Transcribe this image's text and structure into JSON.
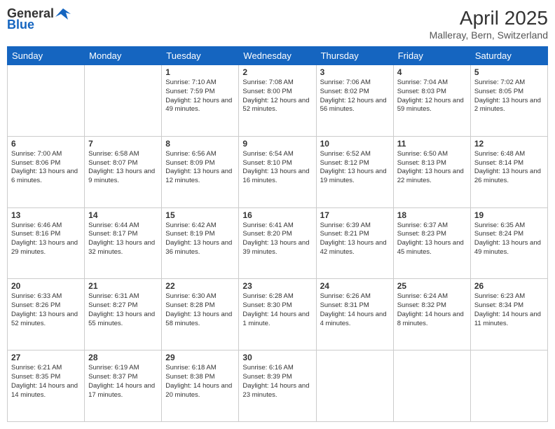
{
  "logo": {
    "general": "General",
    "blue": "Blue"
  },
  "title": "April 2025",
  "location": "Malleray, Bern, Switzerland",
  "days_header": [
    "Sunday",
    "Monday",
    "Tuesday",
    "Wednesday",
    "Thursday",
    "Friday",
    "Saturday"
  ],
  "weeks": [
    [
      {
        "day": "",
        "text": ""
      },
      {
        "day": "",
        "text": ""
      },
      {
        "day": "1",
        "text": "Sunrise: 7:10 AM\nSunset: 7:59 PM\nDaylight: 12 hours and 49 minutes."
      },
      {
        "day": "2",
        "text": "Sunrise: 7:08 AM\nSunset: 8:00 PM\nDaylight: 12 hours and 52 minutes."
      },
      {
        "day": "3",
        "text": "Sunrise: 7:06 AM\nSunset: 8:02 PM\nDaylight: 12 hours and 56 minutes."
      },
      {
        "day": "4",
        "text": "Sunrise: 7:04 AM\nSunset: 8:03 PM\nDaylight: 12 hours and 59 minutes."
      },
      {
        "day": "5",
        "text": "Sunrise: 7:02 AM\nSunset: 8:05 PM\nDaylight: 13 hours and 2 minutes."
      }
    ],
    [
      {
        "day": "6",
        "text": "Sunrise: 7:00 AM\nSunset: 8:06 PM\nDaylight: 13 hours and 6 minutes."
      },
      {
        "day": "7",
        "text": "Sunrise: 6:58 AM\nSunset: 8:07 PM\nDaylight: 13 hours and 9 minutes."
      },
      {
        "day": "8",
        "text": "Sunrise: 6:56 AM\nSunset: 8:09 PM\nDaylight: 13 hours and 12 minutes."
      },
      {
        "day": "9",
        "text": "Sunrise: 6:54 AM\nSunset: 8:10 PM\nDaylight: 13 hours and 16 minutes."
      },
      {
        "day": "10",
        "text": "Sunrise: 6:52 AM\nSunset: 8:12 PM\nDaylight: 13 hours and 19 minutes."
      },
      {
        "day": "11",
        "text": "Sunrise: 6:50 AM\nSunset: 8:13 PM\nDaylight: 13 hours and 22 minutes."
      },
      {
        "day": "12",
        "text": "Sunrise: 6:48 AM\nSunset: 8:14 PM\nDaylight: 13 hours and 26 minutes."
      }
    ],
    [
      {
        "day": "13",
        "text": "Sunrise: 6:46 AM\nSunset: 8:16 PM\nDaylight: 13 hours and 29 minutes."
      },
      {
        "day": "14",
        "text": "Sunrise: 6:44 AM\nSunset: 8:17 PM\nDaylight: 13 hours and 32 minutes."
      },
      {
        "day": "15",
        "text": "Sunrise: 6:42 AM\nSunset: 8:19 PM\nDaylight: 13 hours and 36 minutes."
      },
      {
        "day": "16",
        "text": "Sunrise: 6:41 AM\nSunset: 8:20 PM\nDaylight: 13 hours and 39 minutes."
      },
      {
        "day": "17",
        "text": "Sunrise: 6:39 AM\nSunset: 8:21 PM\nDaylight: 13 hours and 42 minutes."
      },
      {
        "day": "18",
        "text": "Sunrise: 6:37 AM\nSunset: 8:23 PM\nDaylight: 13 hours and 45 minutes."
      },
      {
        "day": "19",
        "text": "Sunrise: 6:35 AM\nSunset: 8:24 PM\nDaylight: 13 hours and 49 minutes."
      }
    ],
    [
      {
        "day": "20",
        "text": "Sunrise: 6:33 AM\nSunset: 8:26 PM\nDaylight: 13 hours and 52 minutes."
      },
      {
        "day": "21",
        "text": "Sunrise: 6:31 AM\nSunset: 8:27 PM\nDaylight: 13 hours and 55 minutes."
      },
      {
        "day": "22",
        "text": "Sunrise: 6:30 AM\nSunset: 8:28 PM\nDaylight: 13 hours and 58 minutes."
      },
      {
        "day": "23",
        "text": "Sunrise: 6:28 AM\nSunset: 8:30 PM\nDaylight: 14 hours and 1 minute."
      },
      {
        "day": "24",
        "text": "Sunrise: 6:26 AM\nSunset: 8:31 PM\nDaylight: 14 hours and 4 minutes."
      },
      {
        "day": "25",
        "text": "Sunrise: 6:24 AM\nSunset: 8:32 PM\nDaylight: 14 hours and 8 minutes."
      },
      {
        "day": "26",
        "text": "Sunrise: 6:23 AM\nSunset: 8:34 PM\nDaylight: 14 hours and 11 minutes."
      }
    ],
    [
      {
        "day": "27",
        "text": "Sunrise: 6:21 AM\nSunset: 8:35 PM\nDaylight: 14 hours and 14 minutes."
      },
      {
        "day": "28",
        "text": "Sunrise: 6:19 AM\nSunset: 8:37 PM\nDaylight: 14 hours and 17 minutes."
      },
      {
        "day": "29",
        "text": "Sunrise: 6:18 AM\nSunset: 8:38 PM\nDaylight: 14 hours and 20 minutes."
      },
      {
        "day": "30",
        "text": "Sunrise: 6:16 AM\nSunset: 8:39 PM\nDaylight: 14 hours and 23 minutes."
      },
      {
        "day": "",
        "text": ""
      },
      {
        "day": "",
        "text": ""
      },
      {
        "day": "",
        "text": ""
      }
    ]
  ]
}
